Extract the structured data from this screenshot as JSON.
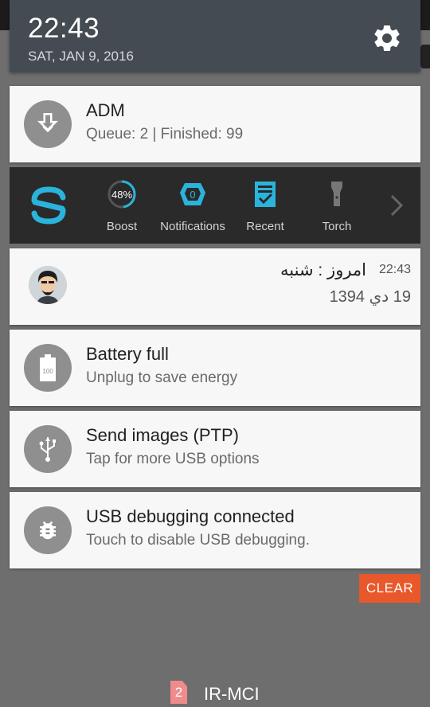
{
  "status_header": {
    "time": "22:43",
    "date": "SAT, JAN 9, 2016"
  },
  "notifications": {
    "adm": {
      "title": "ADM",
      "text": "Queue: 2  |  Finished: 99"
    },
    "persian": {
      "time": "22:43",
      "title": "امروز : شنبه",
      "text": "19 دي 1394"
    },
    "battery": {
      "title": "Battery full",
      "text": "Unplug to save energy",
      "icon_text": "100"
    },
    "ptp": {
      "title": "Send images (PTP)",
      "text": "Tap for more USB options"
    },
    "usb_debug": {
      "title": "USB debugging connected",
      "text": "Touch to disable USB debugging."
    }
  },
  "widget": {
    "boost": {
      "label": "Boost",
      "value": "48%"
    },
    "notifications": {
      "label": "Notifications",
      "count": "0"
    },
    "recent": {
      "label": "Recent"
    },
    "torch": {
      "label": "Torch"
    }
  },
  "clear_label": "CLEAR",
  "carrier": {
    "sim": "2",
    "name": "IR-MCI"
  },
  "colors": {
    "header": "#444b52",
    "accent": "#e8582a",
    "widget_bg": "#2a2a2a",
    "widget_icon": "#2ab4dc",
    "card": "#f7f7f7"
  }
}
